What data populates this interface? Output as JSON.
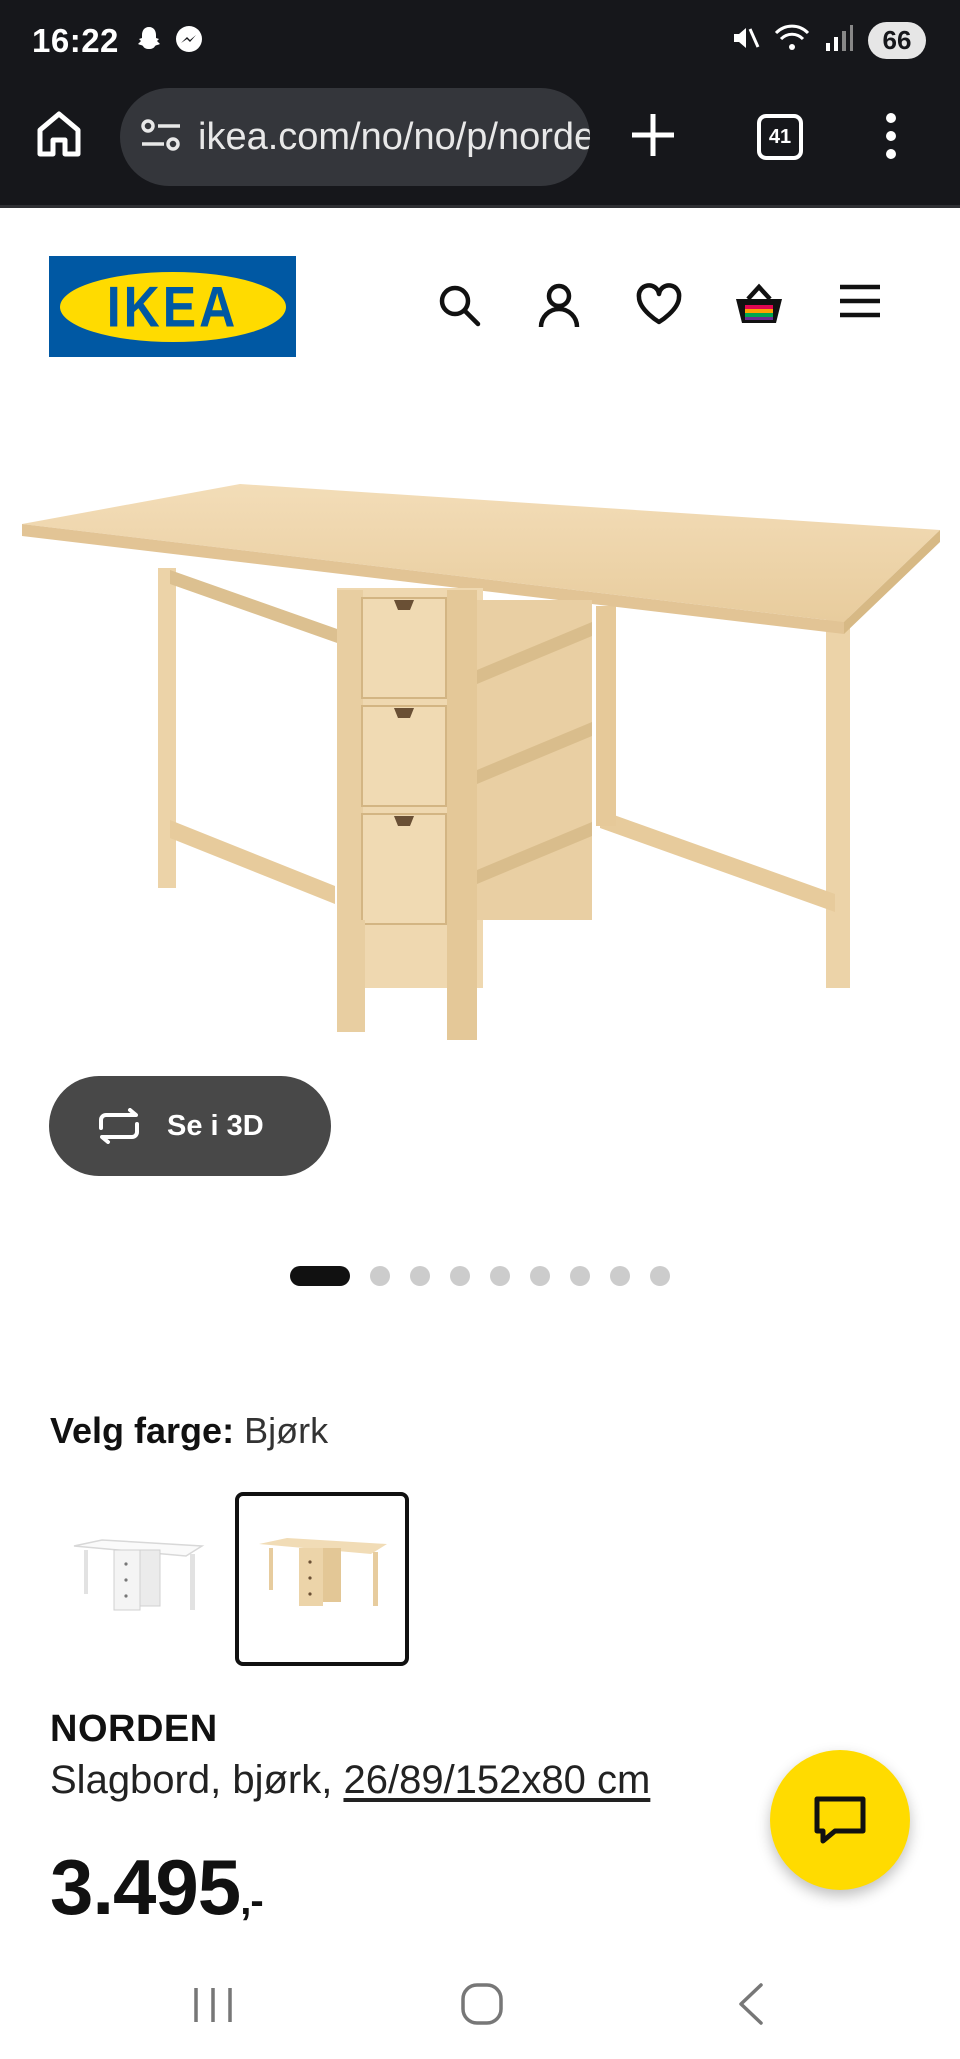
{
  "status_bar": {
    "time": "16:22",
    "battery": "66",
    "icons": [
      "snapchat-icon",
      "messenger-icon",
      "mute-icon",
      "wifi-icon",
      "signal-icon"
    ]
  },
  "browser": {
    "url": "ikea.com/no/no/p/norden",
    "tab_count": "41"
  },
  "header": {
    "logo_text": "IKEA",
    "brand_colors": {
      "blue": "#0058a3",
      "yellow": "#ffdb00"
    },
    "icons": [
      "search-icon",
      "account-icon",
      "heart-icon",
      "basket-icon",
      "menu-icon"
    ]
  },
  "gallery": {
    "view_3d_label": "Se i 3D",
    "image_count": 9,
    "active_index": 0
  },
  "color_select": {
    "label": "Velg farge:",
    "value": "Bjørk",
    "options": [
      {
        "name": "hvit",
        "selected": false
      },
      {
        "name": "bjørk",
        "selected": true
      }
    ]
  },
  "product": {
    "name": "NORDEN",
    "desc_prefix": "Slagbord, bjørk, ",
    "dimensions": "26/89/152x80 cm",
    "price": "3.495",
    "price_suffix": ",-"
  }
}
